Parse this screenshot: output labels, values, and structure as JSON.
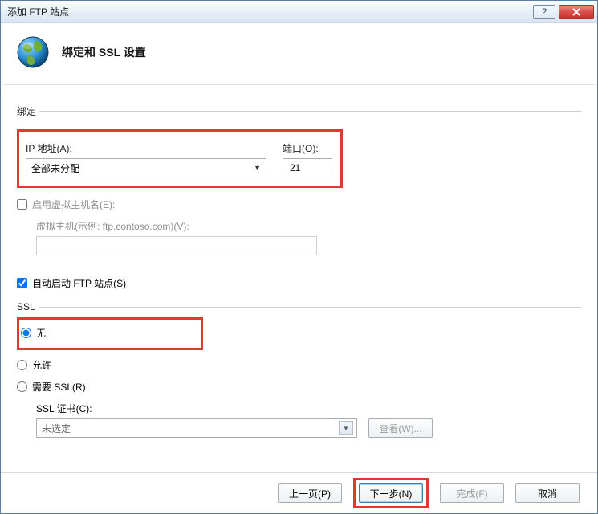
{
  "window": {
    "title": "添加 FTP 站点"
  },
  "header": {
    "title": "绑定和 SSL 设置"
  },
  "binding": {
    "legend": "绑定",
    "ipLabel": "IP 地址(A):",
    "ipValue": "全部未分配",
    "portLabel": "端口(O):",
    "portValue": "21",
    "enableVhostLabel": "启用虚拟主机名(E):",
    "enableVhostChecked": false,
    "vhostHint": "虚拟主机(示例: ftp.contoso.com)(V):"
  },
  "autoStart": {
    "label": "自动启动 FTP 站点(S)",
    "checked": true
  },
  "ssl": {
    "legend": "SSL",
    "optNone": "无",
    "optAllow": "允许",
    "optRequire": "需要 SSL(R)",
    "selected": "none",
    "certLabel": "SSL 证书(C):",
    "certValue": "未选定",
    "viewLabel": "查看(W)..."
  },
  "footer": {
    "prev": "上一页(P)",
    "next": "下一步(N)",
    "finish": "完成(F)",
    "cancel": "取消"
  }
}
